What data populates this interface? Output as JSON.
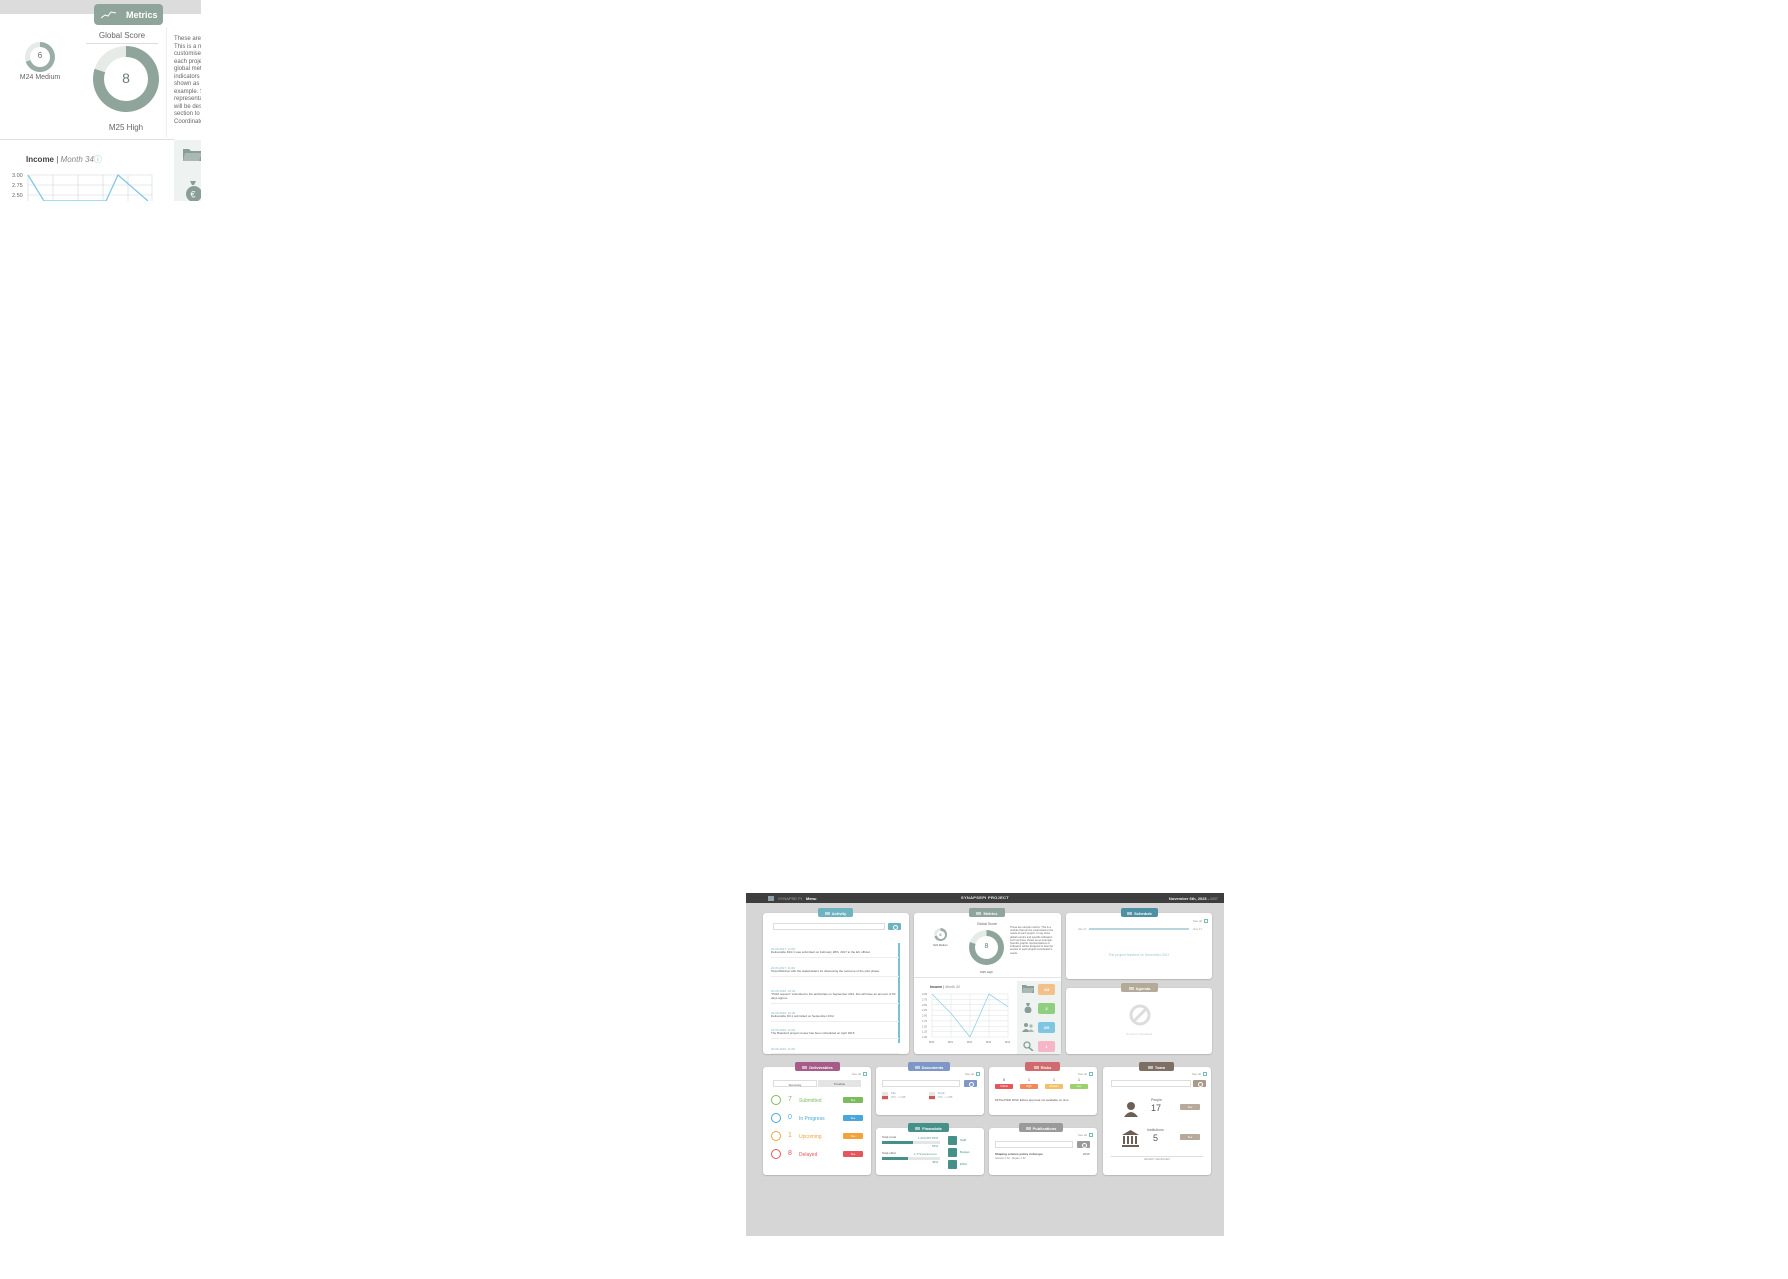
{
  "zoom": {
    "tab_label": "Metrics",
    "global_score_label": "Global Score",
    "small_score": "6",
    "small_score_label": "M24 Medium",
    "big_score": "8",
    "big_score_label": "M25 High",
    "description_lines": [
      "These are",
      "This is a m",
      "customised",
      "each proje",
      "global metr",
      "indicators",
      "shown as a",
      "example. S",
      "representa",
      "will be desi",
      "section to",
      "Coordinato"
    ],
    "income_title": "Income",
    "income_sep": " | ",
    "income_period": "Month 34",
    "income_info": "ⓘ",
    "y_ticks": [
      "3.00",
      "2.75",
      "2.50"
    ]
  },
  "dashboard": {
    "topbar": {
      "brand": "SYNAPSE PI",
      "menu": "Menu",
      "project": "SYNAPSEPI PROJECT",
      "date": "November 6th, 2023",
      "date_suffix": "M37"
    },
    "activity": {
      "tab": "Activity",
      "items": [
        {
          "date": "20.06.2017, 11:00",
          "text": "Deliverable D10.1 was submitted on February 28th, 2017 to the EC official."
        },
        {
          "date": "20.06.2017, 11:00",
          "text": "Telco/Webinar with the stakeholders for discussing the outcome of the pilot phase."
        },
        {
          "date": "20.06.2016, 10:40",
          "text": "\"PGM request\" submitted to the authorities on September 23rd, this will have an amount of 60 days approx."
        },
        {
          "date": "22.06.2016, 10:40",
          "text": "Deliverable D3.1 submitted on September 23rd"
        },
        {
          "date": "22.06.2016, 11:00",
          "text": "The Brainlord project review has been scheduled on April 2015."
        },
        {
          "date": "20.06.2016, 11:00",
          "text": ""
        }
      ]
    },
    "metrics": {
      "tab": "Metrics",
      "global_score_label": "Global Score",
      "small_score": "6",
      "small_label": "M24 Medium",
      "big_score": "8",
      "big_label": "M25 High",
      "description": "These are sample metrics. This is a module that can be customised to the needs of each project. It may show global metrics and specific indicators such as those shown as an example. Specific graphic representations or indicators will be designed to best the section to each project Coordinator's needs.",
      "income_title": "Income",
      "income_period": "Month 34",
      "tiles": [
        {
          "value": "1/3",
          "color": "#f3c08a",
          "icon": "folder-icon"
        },
        {
          "value": "2",
          "color": "#8fcf7f",
          "icon": "money-bag-icon"
        },
        {
          "value": "2/9",
          "color": "#7fc6e3",
          "icon": "people-icon"
        },
        {
          "value": "1",
          "color": "#f5b6c8",
          "icon": "search-icon"
        }
      ]
    },
    "income_chart": {
      "x_labels": [
        "M33",
        "M31",
        "M32",
        "M33",
        "M34"
      ],
      "y_labels": [
        "3.00",
        "2.75",
        "2.50",
        "2.25",
        "2.00",
        "1.75",
        "1.50",
        "1.25",
        "1.00"
      ],
      "values": [
        3.0,
        2.1,
        1.0,
        3.0,
        2.4
      ]
    },
    "schedule": {
      "tab": "Schedule",
      "see_all": "See all",
      "start": "Jan 17",
      "end": "Nov 17",
      "message": "The project finished on December 2017"
    },
    "agenda": {
      "tab": "Agenda",
      "message": "No items scheduled"
    },
    "deliverables": {
      "tab": "Deliverables",
      "see_all": "See all",
      "tab_summary": "Summary",
      "tab_timeline": "Timeline",
      "rows": [
        {
          "count": "7",
          "label": "Submitted",
          "color": "#7cbc5e",
          "btn": "See"
        },
        {
          "count": "0",
          "label": "In Progress",
          "color": "#4aa7d8",
          "btn": "See"
        },
        {
          "count": "1",
          "label": "Upcoming",
          "color": "#f3a23c",
          "btn": "See"
        },
        {
          "count": "8",
          "label": "Delayed",
          "color": "#e5555a",
          "btn": "See"
        }
      ]
    },
    "documents": {
      "tab": "Documents",
      "see_all": "See all",
      "files": [
        {
          "name": "File",
          "meta": "PDF - 1.2MB"
        },
        {
          "name": "Draft",
          "meta": "PDF - 1.4MB"
        }
      ]
    },
    "risks": {
      "tab": "Risks",
      "see_all": "See all",
      "cols": [
        {
          "n": "0",
          "label": "Critical",
          "color": "#e5555a"
        },
        {
          "n": "1",
          "label": "High",
          "color": "#f08a5d"
        },
        {
          "n": "1",
          "label": "Medium",
          "color": "#f3c06a"
        },
        {
          "n": "1",
          "label": "Low",
          "color": "#9ccf6e"
        }
      ],
      "note": "MITIGATED RISK Ethics approval not available on time"
    },
    "team": {
      "tab": "Team",
      "see_all": "See all",
      "people_label": "People",
      "people_count": "17",
      "inst_label": "Institutions",
      "inst_count": "5",
      "btn": "See",
      "footer": "RECENT SEARCHES"
    },
    "financials": {
      "tab": "Financials",
      "total_costs": "Total costs",
      "total_costs_val": "1,234,567.89 €",
      "costs_pct": "53%",
      "total_effort": "Total effort",
      "effort_val": "1,772 person-mo",
      "effort_pct": "45%",
      "links": [
        "Staff",
        "Budget",
        "Effort"
      ]
    },
    "publications": {
      "tab": "Publications",
      "see_all": "See all",
      "title": "Shaping science policy in Europe",
      "authors": "Garcia J.M., Rojas J.M.",
      "year": "2016"
    }
  },
  "colors": {
    "metrics_tab": "#8fa49a",
    "activity_tab": "#6eb3c0",
    "schedule_tab": "#4f8fa3",
    "agenda_tab": "#b3aa98",
    "deliverables_tab": "#a65b88",
    "documents_tab": "#7f97c6",
    "risks_tab": "#d06a6f",
    "team_tab": "#7d6f64",
    "financials_tab": "#46908a",
    "publications_tab": "#9a9a9a"
  }
}
